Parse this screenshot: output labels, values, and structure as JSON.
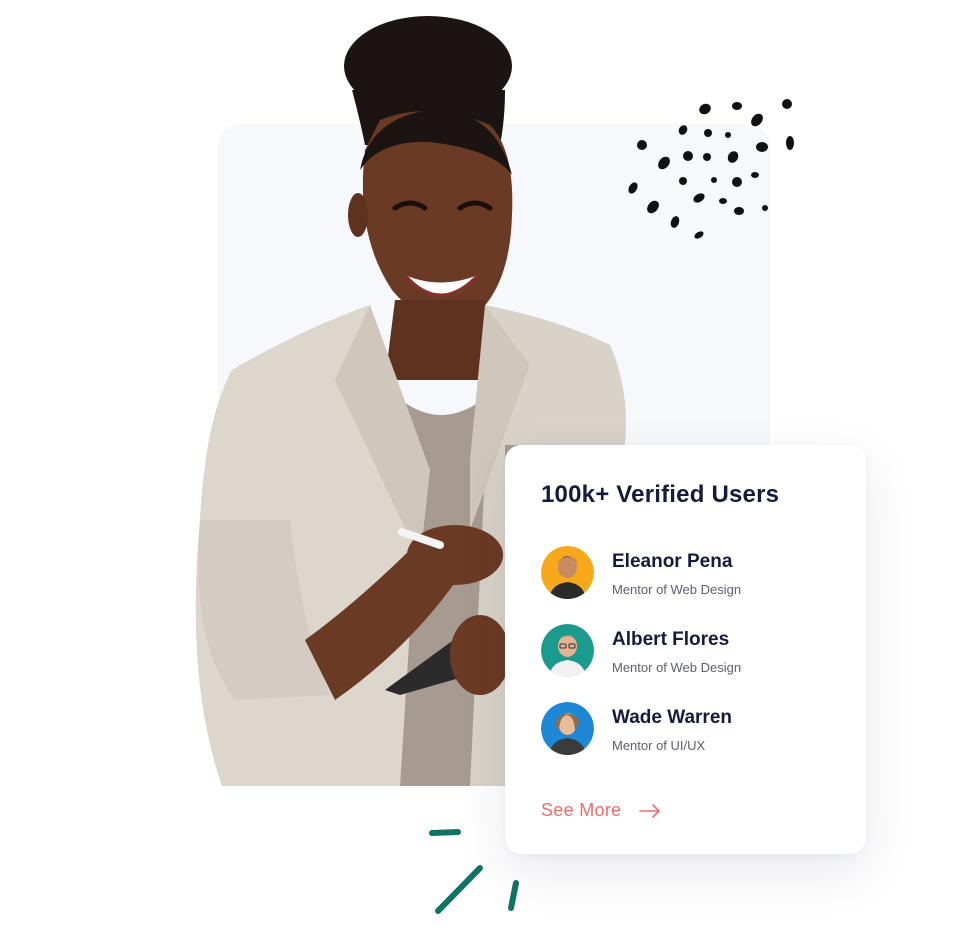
{
  "card": {
    "title": "100k+ Verified Users",
    "users": [
      {
        "name": "Eleanor Pena",
        "role": "Mentor of Web Design",
        "avatar_color": "#f7a81b",
        "avatar_icon": "user-avatar-icon"
      },
      {
        "name": "Albert Flores",
        "role": "Mentor of Web Design",
        "avatar_color": "#1a9b8d",
        "avatar_icon": "user-avatar-icon"
      },
      {
        "name": "Wade Warren",
        "role": "Mentor of UI/UX",
        "avatar_color": "#1e88d6",
        "avatar_icon": "user-avatar-icon"
      }
    ],
    "see_more_label": "See More",
    "see_more_icon": "arrow-right-icon"
  },
  "colors": {
    "accent": "#f26b6b",
    "heading": "#161a3d",
    "muted": "#5d6070",
    "panel_bg": "#f6f8fc",
    "deco_teal": "#0f7466",
    "deco_dots": "#111111"
  }
}
